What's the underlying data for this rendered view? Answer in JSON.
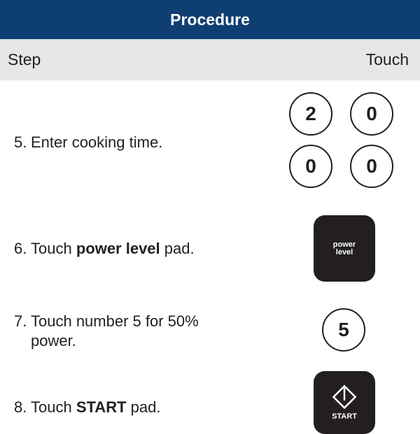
{
  "header": {
    "title": "Procedure"
  },
  "columns": {
    "step": "Step",
    "touch": "Touch"
  },
  "steps": [
    {
      "number": "5.",
      "text": "Enter cooking time."
    },
    {
      "number": "6.",
      "text_before": "Touch ",
      "bold": "power level",
      "text_after": " pad."
    },
    {
      "number": "7.",
      "line1": "Touch number 5 for 50%",
      "line2": "power."
    },
    {
      "number": "8.",
      "text_before": "Touch ",
      "bold": "START",
      "text_after": " pad."
    }
  ],
  "keys": {
    "time_digits": [
      "2",
      "0",
      "0",
      "0"
    ],
    "power_level_label": "power level",
    "number_key": "5",
    "start_label": "START"
  },
  "colors": {
    "header_bg": "#0f3e73",
    "column_header_bg": "#e6e7e8",
    "key_dark": "#231f20"
  }
}
